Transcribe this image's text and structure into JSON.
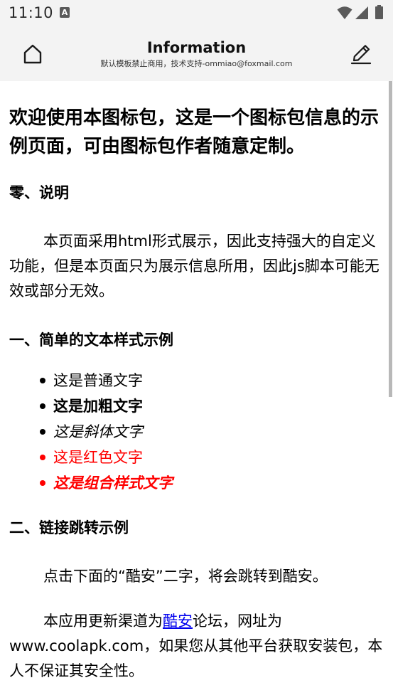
{
  "status_bar": {
    "time": "11:10",
    "notification_glyph": "A",
    "icons": [
      "wifi-icon",
      "signal-icon",
      "battery-icon"
    ]
  },
  "app_bar": {
    "title": "Information",
    "subtitle": "默认模板禁止商用，技术支持-ommiao@foxmail.com",
    "icons": [
      "home-icon",
      "edit-icon"
    ]
  },
  "content": {
    "headline": "欢迎使用本图标包，这是一个图标包信息的示例页面，可由图标包作者随意定制。",
    "section0": {
      "title": "零、说明",
      "paragraph": "本页面采用html形式展示，因此支持强大的自定义功能，但是本页面只为展示信息所用，因此js脚本可能无效或部分无效。"
    },
    "section1": {
      "title": "一、简单的文本样式示例",
      "items": [
        "这是普通文字",
        "这是加粗文字",
        "这是斜体文字",
        "这是红色文字",
        "这是组合样式文字"
      ]
    },
    "section2": {
      "title": "二、链接跳转示例",
      "paragraph1": "点击下面的“酷安”二字，将会跳转到酷安。",
      "p2_before": "本应用更新渠道为",
      "p2_link": "酷安",
      "p2_after": "论坛，网址为www.coolapk.com，如果您从其他平台获取安装包，本人不保证其安全性。"
    }
  },
  "colors": {
    "bar_bg": "#f3f3f3",
    "red_text": "#ff0000",
    "link": "#0000ee",
    "scrollbar": "#b8b8b8"
  }
}
